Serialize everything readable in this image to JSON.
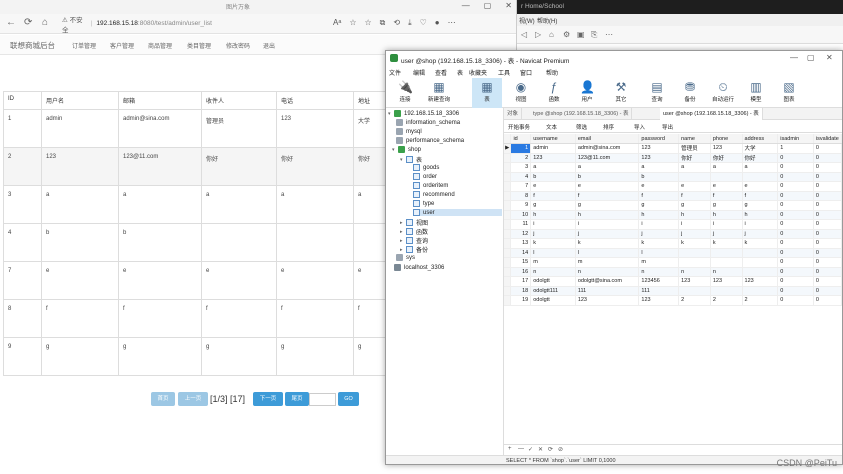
{
  "browser": {
    "title": "图片万象",
    "nav": {
      "back": "←",
      "refresh": "⟳",
      "home": "⌂"
    },
    "address": {
      "warning": "⚠ 不安全",
      "host": "192.168.15.18",
      "path": ":8080/test/admin/user_list"
    },
    "tool_icons": [
      "Aᵃ",
      "☆",
      "☆",
      "⧉",
      "⟲",
      "⤓",
      "♡",
      "●",
      "⋯"
    ],
    "window_controls": [
      "—",
      "▢",
      "✕"
    ]
  },
  "app": {
    "brand": "联想商城后台",
    "menu": [
      "订单管理",
      "客户管理",
      "商品管理",
      "类目管理",
      "修改密码",
      "退出"
    ]
  },
  "user_table": {
    "headers": [
      "ID",
      "用户名",
      "邮箱",
      "收件人",
      "电话",
      "地址"
    ],
    "rows": [
      [
        "1",
        "admin",
        "admin@sina.com",
        "管理员",
        "123",
        "大学"
      ],
      [
        "2",
        "123",
        "123@11.com",
        "你好",
        "你好",
        "你好"
      ],
      [
        "3",
        "a",
        "a",
        "a",
        "a",
        "a"
      ],
      [
        "4",
        "b",
        "b",
        "",
        "",
        ""
      ],
      [
        "7",
        "e",
        "e",
        "e",
        "e",
        "e"
      ],
      [
        "8",
        "f",
        "f",
        "f",
        "f",
        "f"
      ],
      [
        "9",
        "g",
        "g",
        "g",
        "g",
        "g"
      ]
    ]
  },
  "pager": {
    "first": "首页",
    "prev": "上一页",
    "info": "[1/3] [17]",
    "next": "下一页",
    "last": "尾页",
    "go": "GO",
    "input_value": ""
  },
  "back_window": {
    "title": "r Home/School",
    "menu": [
      "视(W)",
      "帮助(H)"
    ],
    "tools": [
      "◁",
      "▷",
      "⌂",
      "⚙",
      "▣",
      "⎘",
      "⋯"
    ]
  },
  "navicat": {
    "title": "user @shop (192.168.15.18_3306) - 表 - Navicat Premium",
    "window_controls": [
      "—",
      "▢",
      "✕"
    ],
    "menu": [
      "文件",
      "编辑",
      "查看",
      "表",
      "收藏夹",
      "工具",
      "窗口",
      "帮助"
    ],
    "toolbar": [
      {
        "label": "连接",
        "icon": "🔌"
      },
      {
        "label": "新建查询",
        "icon": "▦"
      },
      {
        "label": "表",
        "icon": "▦"
      },
      {
        "label": "视图",
        "icon": "◉"
      },
      {
        "label": "函数",
        "icon": "ƒ"
      },
      {
        "label": "用户",
        "icon": "👤"
      },
      {
        "label": "其它",
        "icon": "⚒"
      },
      {
        "label": "查询",
        "icon": "▤"
      },
      {
        "label": "备份",
        "icon": "⛃"
      },
      {
        "label": "自动运行",
        "icon": "⏲"
      },
      {
        "label": "模型",
        "icon": "▥"
      },
      {
        "label": "图表",
        "icon": "▧"
      }
    ],
    "tree": {
      "connection": "192.168.15.18_3306",
      "databases": [
        "information_schema",
        "mysql",
        "performance_schema",
        "shop"
      ],
      "tables_folder": "表",
      "tables": [
        "goods",
        "order",
        "orderitem",
        "recommend",
        "type",
        "user"
      ],
      "other_folders": [
        "视图",
        "函数",
        "查询",
        "备份"
      ],
      "extra_db": "sys",
      "other_connection": "localhost_3306"
    },
    "tabs": [
      "对象",
      "type @shop (192.168.15.18_3306) - 表",
      "user @shop (192.168.15.18_3306) - 表"
    ],
    "subtools": [
      "开始事务",
      "文本",
      "筛选",
      "排序",
      "导入",
      "导出"
    ],
    "grid": {
      "headers": [
        "id",
        "username",
        "email",
        "password",
        "name",
        "phone",
        "address",
        "isadmin",
        "isvalidate"
      ],
      "rows": [
        [
          "1",
          "admin",
          "admin@sina.com",
          "123",
          "管理员",
          "123",
          "大学",
          "1",
          "0"
        ],
        [
          "2",
          "123",
          "123@11.com",
          "123",
          "你好",
          "你好",
          "你好",
          "0",
          "0"
        ],
        [
          "3",
          "a",
          "a",
          "a",
          "a",
          "a",
          "a",
          "0",
          "0"
        ],
        [
          "4",
          "b",
          "b",
          "b",
          "",
          "",
          "",
          "0",
          "0"
        ],
        [
          "7",
          "e",
          "e",
          "e",
          "e",
          "e",
          "e",
          "0",
          "0"
        ],
        [
          "8",
          "f",
          "f",
          "f",
          "f",
          "f",
          "f",
          "0",
          "0"
        ],
        [
          "9",
          "g",
          "g",
          "g",
          "g",
          "g",
          "g",
          "0",
          "0"
        ],
        [
          "10",
          "h",
          "h",
          "h",
          "h",
          "h",
          "h",
          "0",
          "0"
        ],
        [
          "11",
          "i",
          "i",
          "i",
          "i",
          "i",
          "i",
          "0",
          "0"
        ],
        [
          "12",
          "j",
          "j",
          "j",
          "j",
          "j",
          "j",
          "0",
          "0"
        ],
        [
          "13",
          "k",
          "k",
          "k",
          "k",
          "k",
          "k",
          "0",
          "0"
        ],
        [
          "14",
          "l",
          "l",
          "l",
          "",
          "",
          "",
          "0",
          "0"
        ],
        [
          "15",
          "m",
          "m",
          "m",
          "",
          "",
          "",
          "0",
          "0"
        ],
        [
          "16",
          "n",
          "n",
          "n",
          "n",
          "n",
          "",
          "0",
          "0"
        ],
        [
          "17",
          "odolgtt",
          "odolgtt@sina.com",
          "123456",
          "123",
          "123",
          "123",
          "0",
          "0"
        ],
        [
          "18",
          "odolgtt111",
          "111",
          "111",
          "",
          "",
          "",
          "0",
          "0"
        ],
        [
          "19",
          "odolgtt",
          "123",
          "123",
          "2",
          "2",
          "2",
          "0",
          "0"
        ]
      ]
    },
    "bottom_tools": [
      "+",
      "—",
      "✓",
      "✕",
      "⟳",
      "⊘"
    ],
    "status": "SELECT * FROM `shop`.`user` LIMIT 0,1000"
  },
  "watermark": "CSDN @PeiTu"
}
